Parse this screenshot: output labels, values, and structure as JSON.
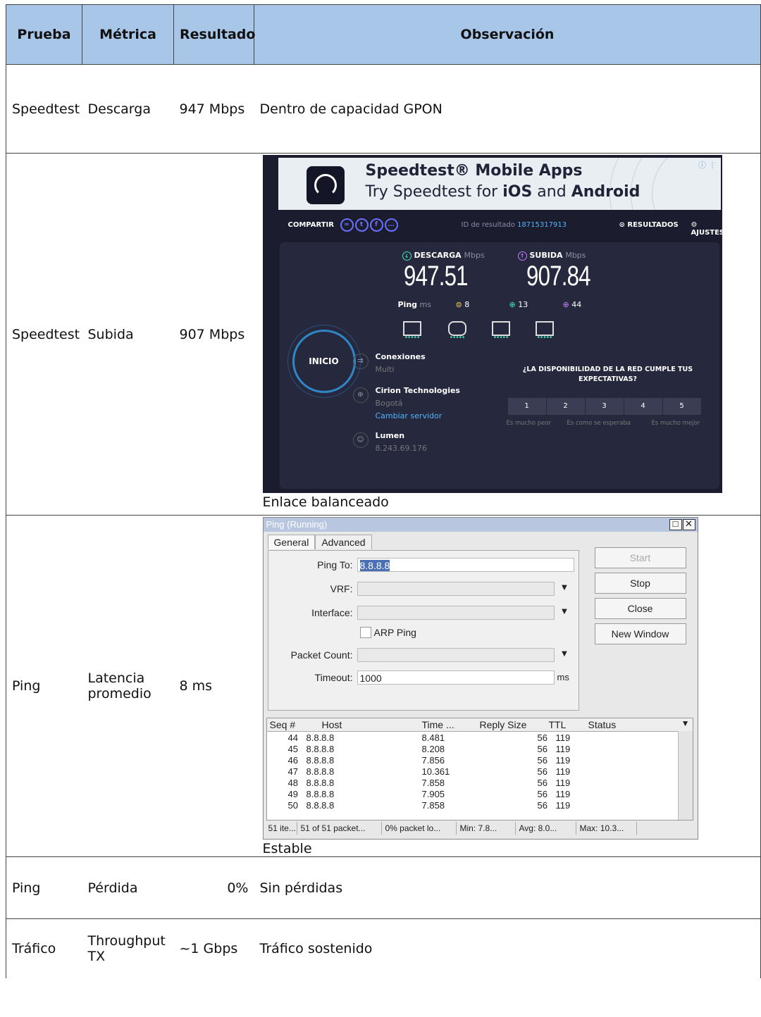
{
  "headers": [
    "Prueba",
    "Métrica",
    "Resultado",
    "Observación"
  ],
  "rows": [
    {
      "prueba": "Speedtest",
      "metrica": "Descarga",
      "resultado": "947 Mbps",
      "observacion": "Dentro de capacidad GPON"
    },
    {
      "prueba": "Speedtest",
      "metrica": "Subida",
      "resultado": "907 Mbps",
      "observacion": "Enlace balanceado"
    },
    {
      "prueba": "Ping",
      "metrica": "Latencia promedio",
      "resultado": "8 ms",
      "observacion": "Estable"
    },
    {
      "prueba": "Ping",
      "metrica": "Pérdida",
      "resultado": "0%",
      "observacion": "Sin pérdidas"
    },
    {
      "prueba": "Tráfico",
      "metrica": "Throughput TX",
      "resultado": "~1 Gbps",
      "observacion": "Tráfico sostenido"
    }
  ],
  "speedtest": {
    "ad_title": "Speedtest® Mobile Apps",
    "ad_line_pre": "Try Speedtest for ",
    "ad_ios": "iOS",
    "ad_and": " and ",
    "ad_android": "Android",
    "ad_info": "ⓘ ⋮",
    "share_label": "COMPARTIR",
    "result_id_label": "ID de resultado ",
    "result_id": "18715317913",
    "results_label": "RESULTADOS",
    "settings_label": "AJUSTES",
    "download_label": "DESCARGA",
    "upload_label": "SUBIDA",
    "unit": "Mbps",
    "download_value": "947.51",
    "upload_value": "907.84",
    "ping_label": "Ping",
    "ping_unit": "ms",
    "ping_idle": "8",
    "ping_down": "13",
    "ping_up": "44",
    "start_label": "INICIO",
    "connections_label": "Conexiones",
    "connections_value": "Multi",
    "server_name": "Cirion Technologies",
    "server_city": "Bogotá",
    "change_server": "Cambiar servidor",
    "isp_name": "Lumen",
    "isp_ip": "8.243.69.176",
    "question": "¿LA DISPONIBILIDAD DE LA RED CUMPLE TUS EXPECTATIVAS?",
    "ratings": [
      "1",
      "2",
      "3",
      "4",
      "5"
    ],
    "rating_low": "Es mucho peor",
    "rating_mid": "Es como se esperaba",
    "rating_high": "Es mucho mejor"
  },
  "ping_window": {
    "title": "Ping (Running)",
    "tab_general": "General",
    "tab_advanced": "Advanced",
    "ping_to_label": "Ping To:",
    "ping_to_value": "8.8.8.8",
    "vrf_label": "VRF:",
    "interface_label": "Interface:",
    "arp_label": "ARP Ping",
    "packet_count_label": "Packet Count:",
    "timeout_label": "Timeout:",
    "timeout_value": "1000",
    "timeout_unit": "ms",
    "btn_start": "Start",
    "btn_stop": "Stop",
    "btn_close": "Close",
    "btn_new": "New Window",
    "columns": [
      "Seq #",
      "Host",
      "Time ...",
      "Reply Size",
      "TTL",
      "Status"
    ],
    "results": [
      {
        "seq": "44",
        "host": "8.8.8.8",
        "time": "8.481",
        "size": "56",
        "ttl": "119"
      },
      {
        "seq": "45",
        "host": "8.8.8.8",
        "time": "8.208",
        "size": "56",
        "ttl": "119"
      },
      {
        "seq": "46",
        "host": "8.8.8.8",
        "time": "7.856",
        "size": "56",
        "ttl": "119"
      },
      {
        "seq": "47",
        "host": "8.8.8.8",
        "time": "10.361",
        "size": "56",
        "ttl": "119"
      },
      {
        "seq": "48",
        "host": "8.8.8.8",
        "time": "7.858",
        "size": "56",
        "ttl": "119"
      },
      {
        "seq": "49",
        "host": "8.8.8.8",
        "time": "7.905",
        "size": "56",
        "ttl": "119"
      },
      {
        "seq": "50",
        "host": "8.8.8.8",
        "time": "7.858",
        "size": "56",
        "ttl": "119"
      }
    ],
    "status_items": "51 ite...",
    "status_packets": "51 of 51 packet...",
    "status_loss": "0% packet lo...",
    "status_min": "Min: 7.8...",
    "status_avg": "Avg: 8.0...",
    "status_max": "Max: 10.3..."
  }
}
